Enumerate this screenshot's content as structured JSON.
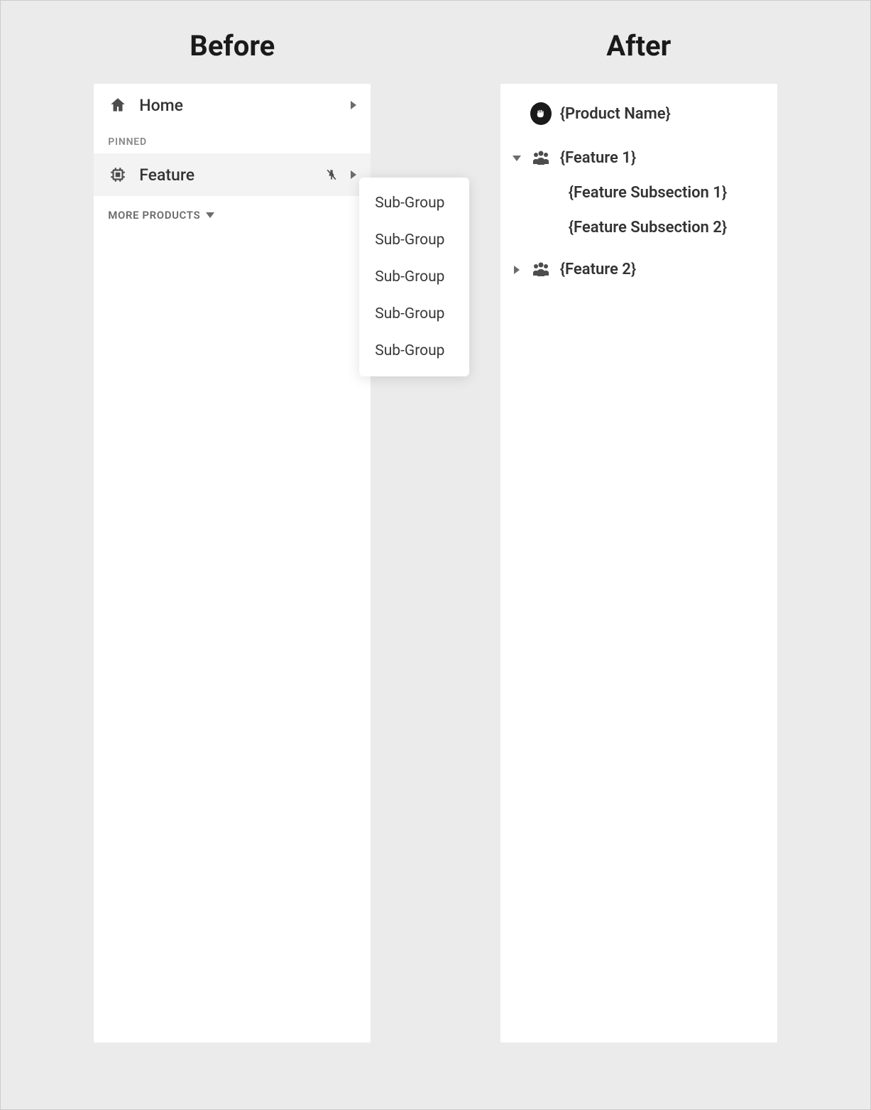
{
  "headings": {
    "before": "Before",
    "after": "After"
  },
  "before": {
    "home": "Home",
    "pinned_label": "PINNED",
    "feature": "Feature",
    "more_products": "MORE PRODUCTS",
    "subgroups": [
      "Sub-Group",
      "Sub-Group",
      "Sub-Group",
      "Sub-Group",
      "Sub-Group"
    ]
  },
  "after": {
    "product": "{Product Name}",
    "feature1": "{Feature 1}",
    "sub1": "{Feature Subsection 1}",
    "sub2": "{Feature Subsection 2}",
    "feature2": "{Feature 2}"
  }
}
